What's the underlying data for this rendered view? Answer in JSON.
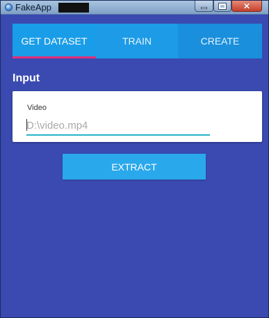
{
  "window": {
    "title": "FakeApp",
    "icon": "app-icon",
    "controls": {
      "minimize_icon": "minimize-icon",
      "maximize_icon": "maximize-icon",
      "close_glyph": "✕"
    }
  },
  "tabs": [
    {
      "label": "GET DATASET",
      "active": true
    },
    {
      "label": "TRAIN",
      "active": false
    },
    {
      "label": "CREATE",
      "active": false
    }
  ],
  "section": {
    "title": "Input"
  },
  "video_field": {
    "label": "Video",
    "value": "",
    "placeholder": "D:\\video.mp4"
  },
  "extract_button": {
    "label": "EXTRACT"
  },
  "colors": {
    "background": "#3a4ab0",
    "tab_bar": "#1d9be6",
    "tab_indicator": "#e0307a",
    "field_underline": "#26b3c9",
    "button": "#2aa8ec"
  }
}
